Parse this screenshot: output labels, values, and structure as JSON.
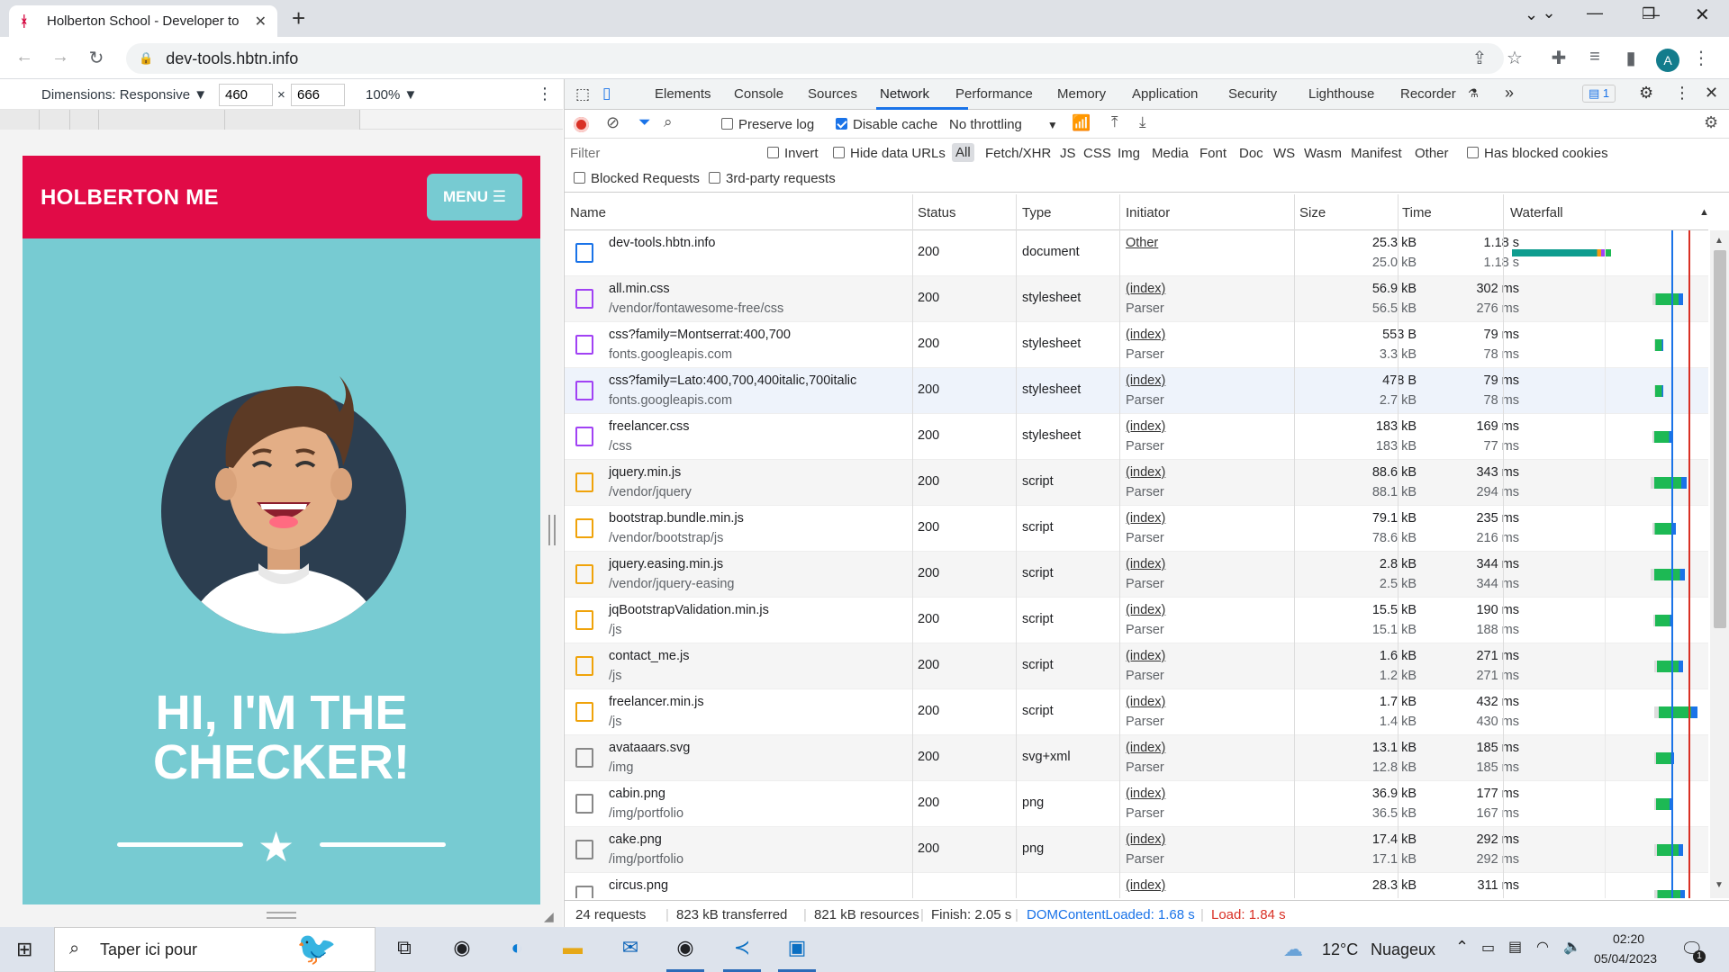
{
  "browser": {
    "tab_title": "Holberton School - Developer to",
    "url": "dev-tools.hbtn.info",
    "avatar_letter": "A"
  },
  "device_toolbar": {
    "dimensions": "Dimensions: Responsive ▼",
    "width": "460",
    "height": "666",
    "times": "×",
    "zoom": "100% ▼"
  },
  "site": {
    "brand": "HOLBERTON ME",
    "menu": "MENU ☰",
    "hero_line1": "HI, I'M THE",
    "hero_line2": "CHECKER!",
    "colors": {
      "header": "#e10b47",
      "body": "#77cbd2"
    }
  },
  "devtools": {
    "tabs": [
      "Elements",
      "Console",
      "Sources",
      "Network",
      "Performance",
      "Memory",
      "Application",
      "Security",
      "Lighthouse",
      "Recorder"
    ],
    "active_tab": "Network",
    "more_tabs": "»",
    "issues_count": "1",
    "network_toolbar": {
      "preserve_log": "Preserve log",
      "disable_cache": "Disable cache",
      "throttling": "No throttling"
    },
    "filter": {
      "placeholder": "Filter",
      "invert": "Invert",
      "hide_data_urls": "Hide data URLs",
      "types": [
        "All",
        "Fetch/XHR",
        "JS",
        "CSS",
        "Img",
        "Media",
        "Font",
        "Doc",
        "WS",
        "Wasm",
        "Manifest",
        "Other"
      ],
      "has_blocked_cookies": "Has blocked cookies",
      "blocked_requests": "Blocked Requests",
      "third_party": "3rd-party requests"
    },
    "columns": {
      "name": "Name",
      "status": "Status",
      "type": "Type",
      "initiator": "Initiator",
      "size": "Size",
      "time": "Time",
      "waterfall": "Waterfall"
    },
    "rows": [
      {
        "name": "dev-tools.hbtn.info",
        "path": "",
        "status": "200",
        "type": "document",
        "initiator": "Other",
        "initiator2": "",
        "size": "25.3 kB",
        "size2": "25.0 kB",
        "time": "1.18 s",
        "time2": "1.18 s",
        "icon": "document-icon"
      },
      {
        "name": "all.min.css",
        "path": "/vendor/fontawesome-free/css",
        "status": "200",
        "type": "stylesheet",
        "initiator": "(index)",
        "initiator2": "Parser",
        "size": "56.9 kB",
        "size2": "56.5 kB",
        "time": "302 ms",
        "time2": "276 ms",
        "icon": "stylesheet-icon"
      },
      {
        "name": "css?family=Montserrat:400,700",
        "path": "fonts.googleapis.com",
        "status": "200",
        "type": "stylesheet",
        "initiator": "(index)",
        "initiator2": "Parser",
        "size": "553 B",
        "size2": "3.3 kB",
        "time": "79 ms",
        "time2": "78 ms",
        "icon": "stylesheet-icon"
      },
      {
        "name": "css?family=Lato:400,700,400italic,700italic",
        "path": "fonts.googleapis.com",
        "status": "200",
        "type": "stylesheet",
        "initiator": "(index)",
        "initiator2": "Parser",
        "size": "478 B",
        "size2": "2.7 kB",
        "time": "79 ms",
        "time2": "78 ms",
        "icon": "stylesheet-icon"
      },
      {
        "name": "freelancer.css",
        "path": "/css",
        "status": "200",
        "type": "stylesheet",
        "initiator": "(index)",
        "initiator2": "Parser",
        "size": "183 kB",
        "size2": "183 kB",
        "time": "169 ms",
        "time2": "77 ms",
        "icon": "stylesheet-icon"
      },
      {
        "name": "jquery.min.js",
        "path": "/vendor/jquery",
        "status": "200",
        "type": "script",
        "initiator": "(index)",
        "initiator2": "Parser",
        "size": "88.6 kB",
        "size2": "88.1 kB",
        "time": "343 ms",
        "time2": "294 ms",
        "icon": "script-icon"
      },
      {
        "name": "bootstrap.bundle.min.js",
        "path": "/vendor/bootstrap/js",
        "status": "200",
        "type": "script",
        "initiator": "(index)",
        "initiator2": "Parser",
        "size": "79.1 kB",
        "size2": "78.6 kB",
        "time": "235 ms",
        "time2": "216 ms",
        "icon": "script-icon"
      },
      {
        "name": "jquery.easing.min.js",
        "path": "/vendor/jquery-easing",
        "status": "200",
        "type": "script",
        "initiator": "(index)",
        "initiator2": "Parser",
        "size": "2.8 kB",
        "size2": "2.5 kB",
        "time": "344 ms",
        "time2": "344 ms",
        "icon": "script-icon"
      },
      {
        "name": "jqBootstrapValidation.min.js",
        "path": "/js",
        "status": "200",
        "type": "script",
        "initiator": "(index)",
        "initiator2": "Parser",
        "size": "15.5 kB",
        "size2": "15.1 kB",
        "time": "190 ms",
        "time2": "188 ms",
        "icon": "script-icon"
      },
      {
        "name": "contact_me.js",
        "path": "/js",
        "status": "200",
        "type": "script",
        "initiator": "(index)",
        "initiator2": "Parser",
        "size": "1.6 kB",
        "size2": "1.2 kB",
        "time": "271 ms",
        "time2": "271 ms",
        "icon": "script-icon"
      },
      {
        "name": "freelancer.min.js",
        "path": "/js",
        "status": "200",
        "type": "script",
        "initiator": "(index)",
        "initiator2": "Parser",
        "size": "1.7 kB",
        "size2": "1.4 kB",
        "time": "432 ms",
        "time2": "430 ms",
        "icon": "script-icon"
      },
      {
        "name": "avataaars.svg",
        "path": "/img",
        "status": "200",
        "type": "svg+xml",
        "initiator": "(index)",
        "initiator2": "Parser",
        "size": "13.1 kB",
        "size2": "12.8 kB",
        "time": "185 ms",
        "time2": "185 ms",
        "icon": "image-icon"
      },
      {
        "name": "cabin.png",
        "path": "/img/portfolio",
        "status": "200",
        "type": "png",
        "initiator": "(index)",
        "initiator2": "Parser",
        "size": "36.9 kB",
        "size2": "36.5 kB",
        "time": "177 ms",
        "time2": "167 ms",
        "icon": "image-icon"
      },
      {
        "name": "cake.png",
        "path": "/img/portfolio",
        "status": "200",
        "type": "png",
        "initiator": "(index)",
        "initiator2": "Parser",
        "size": "17.4 kB",
        "size2": "17.1 kB",
        "time": "292 ms",
        "time2": "292 ms",
        "icon": "image-icon"
      },
      {
        "name": "circus.png",
        "path": "",
        "status": "",
        "type": "",
        "initiator": "(index)",
        "initiator2": "",
        "size": "28.3 kB",
        "size2": "",
        "time": "311 ms",
        "time2": "",
        "icon": "image-icon"
      }
    ],
    "status_bar": {
      "requests": "24 requests",
      "transferred": "823 kB transferred",
      "resources": "821 kB resources",
      "finish": "Finish: 2.05 s",
      "dom_loaded": "DOMContentLoaded: 1.68 s",
      "load": "Load: 1.84 s"
    }
  },
  "taskbar": {
    "search_placeholder": "Taper ici pour",
    "weather_temp": "12°C",
    "weather_desc": "Nuageux",
    "time": "02:20",
    "date": "05/04/2023",
    "notifications": "1"
  }
}
